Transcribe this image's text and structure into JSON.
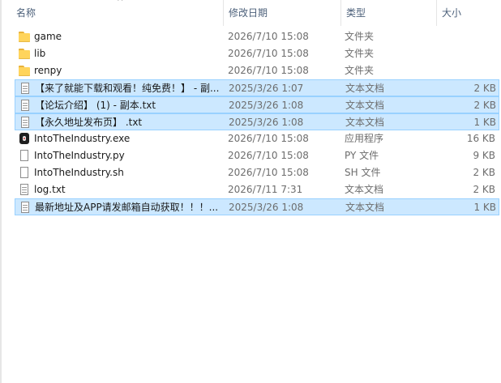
{
  "columns": {
    "name": "名称",
    "date": "修改日期",
    "type": "类型",
    "size": "大小"
  },
  "sort_indicator": "^",
  "files": [
    {
      "name": "game",
      "date": "2026/7/10 15:08",
      "type": "文件夹",
      "size": "",
      "icon": "folder-icon",
      "selected": false
    },
    {
      "name": "lib",
      "date": "2026/7/10 15:08",
      "type": "文件夹",
      "size": "",
      "icon": "folder-icon",
      "selected": false
    },
    {
      "name": "renpy",
      "date": "2026/7/10 15:08",
      "type": "文件夹",
      "size": "",
      "icon": "folder-icon",
      "selected": false
    },
    {
      "name": "【来了就能下载和观看！纯免费！】 - 副...",
      "date": "2025/3/26 1:07",
      "type": "文本文档",
      "size": "2 KB",
      "icon": "text-document-icon",
      "selected": true
    },
    {
      "name": "【论坛介绍】 (1) - 副本.txt",
      "date": "2025/3/26 1:08",
      "type": "文本文档",
      "size": "2 KB",
      "icon": "text-document-icon",
      "selected": true
    },
    {
      "name": "【永久地址发布页】 .txt",
      "date": "2025/3/26 1:08",
      "type": "文本文档",
      "size": "1 KB",
      "icon": "text-document-icon",
      "selected": true
    },
    {
      "name": "IntoTheIndustry.exe",
      "date": "2026/7/10 15:08",
      "type": "应用程序",
      "size": "16 KB",
      "icon": "application-icon",
      "selected": false
    },
    {
      "name": "IntoTheIndustry.py",
      "date": "2026/7/10 15:08",
      "type": "PY 文件",
      "size": "9 KB",
      "icon": "file-icon",
      "selected": false
    },
    {
      "name": "IntoTheIndustry.sh",
      "date": "2026/7/10 15:08",
      "type": "SH 文件",
      "size": "2 KB",
      "icon": "file-icon",
      "selected": false
    },
    {
      "name": "log.txt",
      "date": "2026/7/11 7:31",
      "type": "文本文档",
      "size": "2 KB",
      "icon": "text-document-icon",
      "selected": false
    },
    {
      "name": "最新地址及APP请发邮箱自动获取！！！...",
      "date": "2025/3/26 1:08",
      "type": "文本文档",
      "size": "1 KB",
      "icon": "text-document-icon",
      "selected": true
    }
  ]
}
